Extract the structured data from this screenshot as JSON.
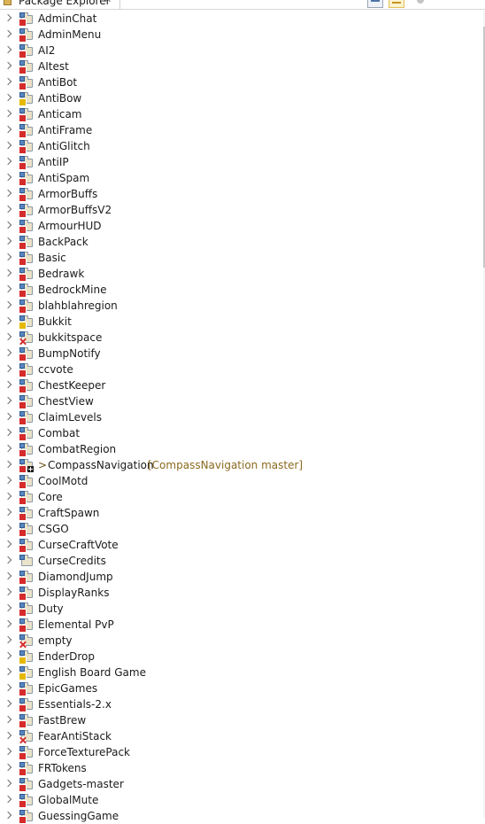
{
  "view": {
    "title": "Package Explorer",
    "close_glyph": "✕",
    "toolbar": [
      "collapse-all-icon",
      "link-with-editor-icon",
      "view-menu-icon"
    ]
  },
  "projects": [
    {
      "name": "AdminChat",
      "state": "error"
    },
    {
      "name": "AdminMenu",
      "state": "error"
    },
    {
      "name": "AI2",
      "state": "error"
    },
    {
      "name": "AItest",
      "state": "error"
    },
    {
      "name": "AntiBot",
      "state": "error"
    },
    {
      "name": "AntiBow",
      "state": "warn"
    },
    {
      "name": "Anticam",
      "state": "error"
    },
    {
      "name": "AntiFrame",
      "state": "error"
    },
    {
      "name": "AntiGlitch",
      "state": "error"
    },
    {
      "name": "AntiIP",
      "state": "error"
    },
    {
      "name": "AntiSpam",
      "state": "error"
    },
    {
      "name": "ArmorBuffs",
      "state": "error"
    },
    {
      "name": "ArmorBuffsV2",
      "state": "error"
    },
    {
      "name": "ArmourHUD",
      "state": "error"
    },
    {
      "name": "BackPack",
      "state": "error"
    },
    {
      "name": "Basic",
      "state": "error"
    },
    {
      "name": "Bedrawk",
      "state": "error"
    },
    {
      "name": "BedrockMine",
      "state": "error"
    },
    {
      "name": "blahblahregion",
      "state": "error"
    },
    {
      "name": "Bukkit",
      "state": "warn"
    },
    {
      "name": "bukkitspace",
      "state": "error-x"
    },
    {
      "name": "BumpNotify",
      "state": "error"
    },
    {
      "name": "ccvote",
      "state": "error"
    },
    {
      "name": "ChestKeeper",
      "state": "error"
    },
    {
      "name": "ChestView",
      "state": "error"
    },
    {
      "name": "ClaimLevels",
      "state": "error"
    },
    {
      "name": "Combat",
      "state": "error"
    },
    {
      "name": "CombatRegion",
      "state": "error"
    },
    {
      "name": "CompassNavigation",
      "state": "error",
      "git": true,
      "dirty": ">",
      "repo": "[CompassNavigation master]"
    },
    {
      "name": "CoolMotd",
      "state": "error"
    },
    {
      "name": "Core",
      "state": "error"
    },
    {
      "name": "CraftSpawn",
      "state": "error"
    },
    {
      "name": "CSGO",
      "state": "error"
    },
    {
      "name": "CurseCraftVote",
      "state": "error"
    },
    {
      "name": "CurseCredits",
      "state": "none"
    },
    {
      "name": "DiamondJump",
      "state": "error"
    },
    {
      "name": "DisplayRanks",
      "state": "error"
    },
    {
      "name": "Duty",
      "state": "error"
    },
    {
      "name": "Elemental PvP",
      "state": "error"
    },
    {
      "name": "empty",
      "state": "error-x"
    },
    {
      "name": "EnderDrop",
      "state": "warn"
    },
    {
      "name": "English Board Game",
      "state": "warn"
    },
    {
      "name": "EpicGames",
      "state": "error"
    },
    {
      "name": "Essentials-2.x",
      "state": "error"
    },
    {
      "name": "FastBrew",
      "state": "error"
    },
    {
      "name": "FearAntiStack",
      "state": "error-x"
    },
    {
      "name": "ForceTexturePack",
      "state": "error"
    },
    {
      "name": "FRTokens",
      "state": "error"
    },
    {
      "name": "Gadgets-master",
      "state": "error"
    },
    {
      "name": "GlobalMute",
      "state": "error"
    },
    {
      "name": "GuessingGame",
      "state": "error"
    }
  ]
}
